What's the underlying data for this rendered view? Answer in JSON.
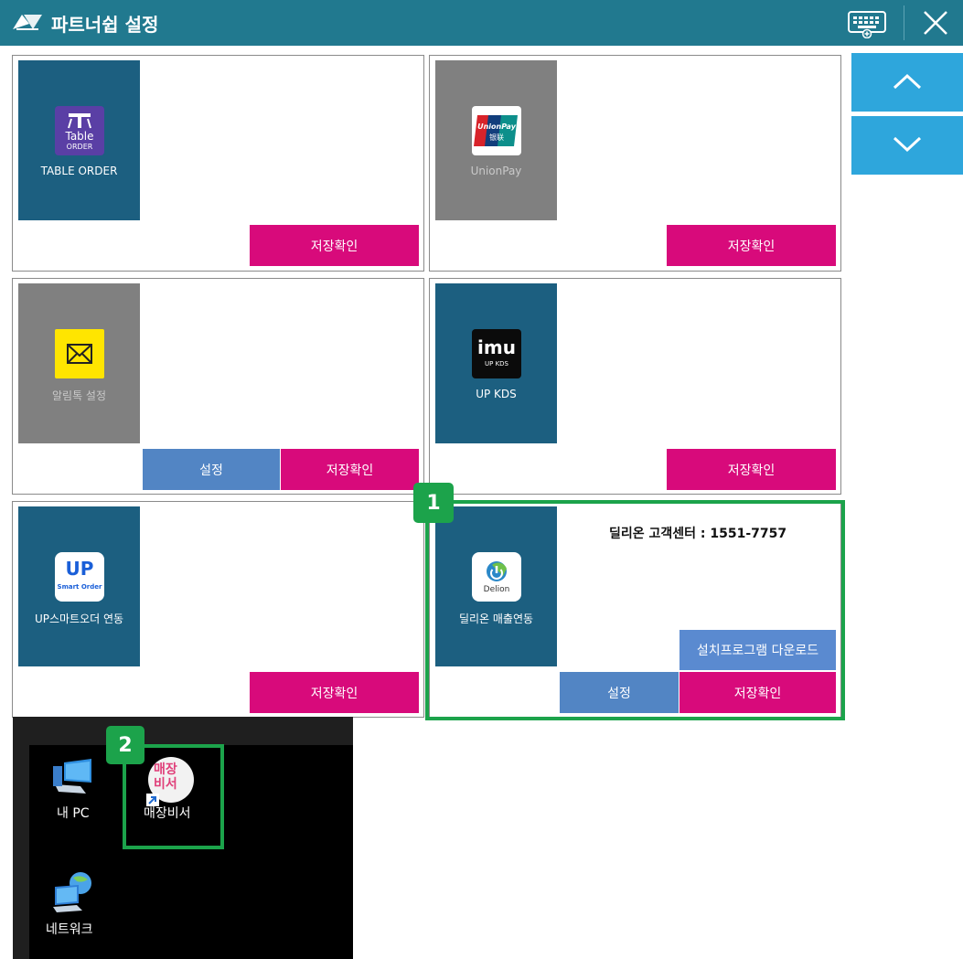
{
  "window": {
    "title": "파트너쉽 설정",
    "accent": "#21798f"
  },
  "cards": [
    {
      "tile_label": "TABLE ORDER",
      "icon": "table-order-icon",
      "save_label": "저장확인"
    },
    {
      "tile_label": "UnionPay",
      "icon": "unionpay-icon",
      "save_label": "저장확인"
    },
    {
      "tile_label": "알림톡 설정",
      "icon": "envelope-icon",
      "settings_label": "설정",
      "save_label": "저장확인"
    },
    {
      "tile_label": "UP KDS",
      "icon": "imu-kds-icon",
      "icon_brand": "imu",
      "icon_sub": "UP KDS",
      "save_label": "저장확인"
    },
    {
      "tile_label": "UP스마트오더 연동",
      "icon": "up-smart-order-icon",
      "icon_brand": "UP",
      "icon_sub": "Smart Order",
      "save_label": "저장확인"
    },
    {
      "tile_label": "딜리온 매출연동",
      "icon": "delion-icon",
      "icon_sub": "Delion",
      "phone": "딜리온 고객센터 : 1551-7757",
      "download_label": "설치프로그램 다운로드",
      "settings_label": "설정",
      "save_label": "저장확인"
    }
  ],
  "table_order_icon_text": {
    "line1": "Table",
    "line2": "ORDER"
  },
  "unionpay_icon_text": {
    "line1": "UnionPay",
    "line2": "银联"
  },
  "markers": [
    "1",
    "2"
  ],
  "desktop": {
    "items": [
      {
        "label": "내 PC",
        "icon": "pc-icon"
      },
      {
        "label": "매장비서",
        "icon": "store-secretary-icon",
        "icon_text": "매장비서"
      },
      {
        "label": "네트워크",
        "icon": "network-icon"
      }
    ]
  },
  "colors": {
    "save": "#d80a7b",
    "settings": "#5285c4",
    "scroll": "#2ea6dc",
    "highlight": "#1ca34b",
    "tile": "#1c5f80",
    "tile_disabled": "#808080"
  }
}
